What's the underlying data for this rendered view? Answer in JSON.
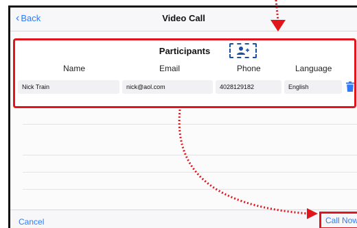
{
  "navbar": {
    "back_label": "Back",
    "title": "Video Call"
  },
  "participants": {
    "heading": "Participants",
    "add_icon": "add-person-icon",
    "columns": [
      "Name",
      "Email",
      "Phone",
      "Language"
    ],
    "rows": [
      {
        "name": "Nick Train",
        "email": "nick@aol.com",
        "phone": "4028129182",
        "language": "English"
      }
    ]
  },
  "toolbar": {
    "cancel_label": "Cancel",
    "call_now_label": "Call Now"
  },
  "colors": {
    "accent": "#2f7bf6",
    "highlight": "#e0161c",
    "add_border": "#1b4fa0"
  }
}
